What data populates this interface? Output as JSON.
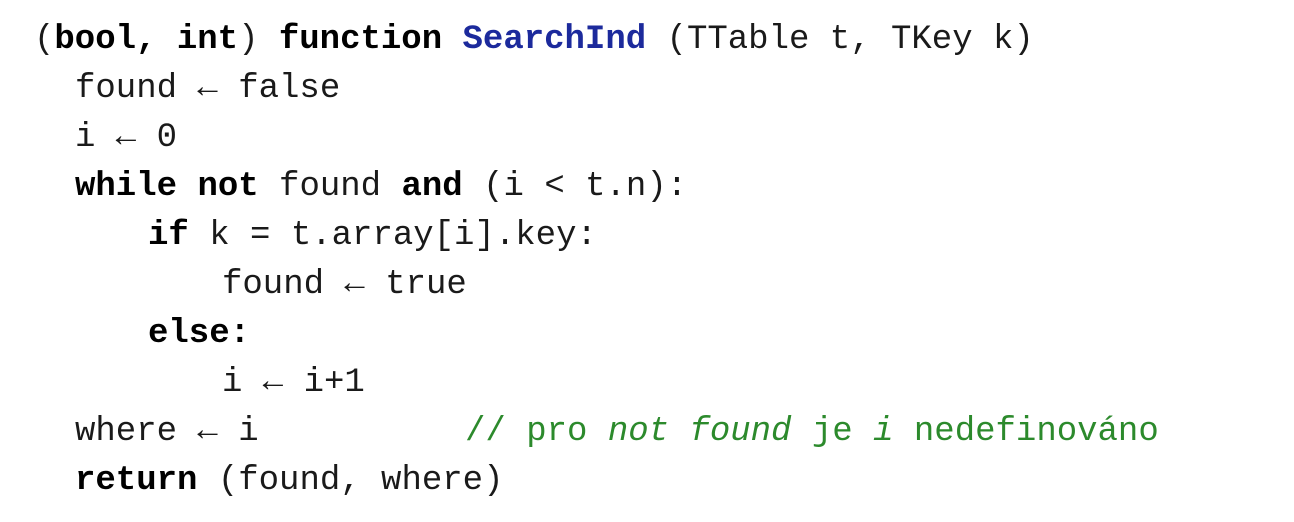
{
  "colors": {
    "text": "#1a1a1a",
    "keyword": "#000000",
    "function_name": "#1c2a9c",
    "comment": "#2c8a2c",
    "background": "#ffffff"
  },
  "code": {
    "l1": {
      "open_paren": "(",
      "type_bool": "bool",
      "comma1": ", ",
      "type_int": "int",
      "close_paren": ") ",
      "kw_function": "function",
      "space": " ",
      "fn_name": "SearchInd",
      "params": " (TTable t, TKey k)"
    },
    "l2": {
      "text": "found ← false"
    },
    "l3": {
      "text": "i ← 0"
    },
    "l4": {
      "kw_while": "while",
      "sp1": " ",
      "kw_not": "not",
      "mid": " found ",
      "kw_and": "and",
      "cond": " (i < t.n):"
    },
    "l5": {
      "kw_if": "if",
      "cond": " k = t.array[i].key:"
    },
    "l6": {
      "text": "found ← true"
    },
    "l7": {
      "kw_else": "else",
      "colon": ":"
    },
    "l8": {
      "text": "i ← i+1"
    },
    "l9": {
      "code": "where ← i",
      "comment_prefix": "// pro ",
      "comment_not_found": "not found",
      "comment_je": " je ",
      "comment_i": "i",
      "comment_rest": " nedefinováno"
    },
    "l10": {
      "kw_return": "return",
      "rest": " (found, where)"
    }
  }
}
